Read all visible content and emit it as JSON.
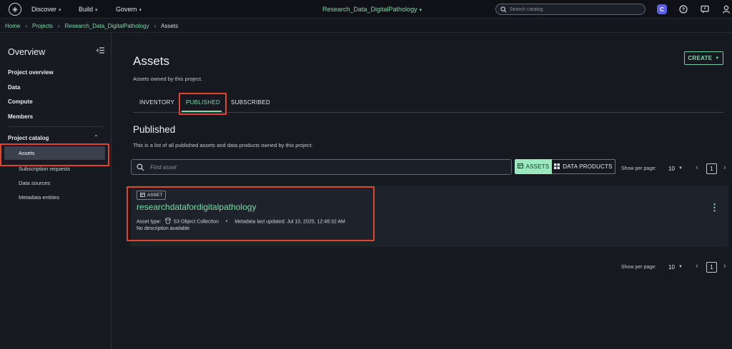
{
  "topbar": {
    "nav": [
      {
        "label": "Discover"
      },
      {
        "label": "Build"
      },
      {
        "label": "Govern"
      }
    ],
    "project": "Research_Data_DigitalPathology",
    "search_placeholder": "Search catalog",
    "icons": [
      "app-logo-icon",
      "search-icon",
      "user-badge-icon",
      "help-icon",
      "feedback-icon",
      "profile-icon"
    ]
  },
  "breadcrumb": [
    "Home",
    "Projects",
    "Research_Data_DigitalPathology",
    "Assets"
  ],
  "sidebar": {
    "title": "Overview",
    "links": [
      "Project overview",
      "Data",
      "Compute",
      "Members"
    ],
    "section": "Project catalog",
    "items": [
      "Assets",
      "Subscription requests",
      "Data sources",
      "Metadata entities"
    ],
    "active": "Assets"
  },
  "main": {
    "title": "Assets",
    "subtitle": "Assets owned by this project.",
    "create_label": "CREATE",
    "tabs": [
      "INVENTORY",
      "PUBLISHED",
      "SUBSCRIBED"
    ],
    "active_tab": "PUBLISHED",
    "section_title": "Published",
    "section_desc": "This is a list of all published assets and data products owned by this project.",
    "find_placeholder": "Find asset",
    "toggle": {
      "assets": "ASSETS",
      "data_products": "DATA PRODUCTS"
    },
    "pager": {
      "label": "Show per page:",
      "per_page": "10",
      "page": "1"
    }
  },
  "asset": {
    "badge": "ASSET",
    "name": "researchdatafordigitalpathology",
    "type_label": "Asset type:",
    "type_value": "S3 Object Collection",
    "updated": "Metadata last updated: Jul 10, 2025, 12:48:32 AM",
    "description": "No description available"
  },
  "colors": {
    "accent": "#7fd9a8",
    "highlight": "#e0442c",
    "background": "#16191f"
  }
}
